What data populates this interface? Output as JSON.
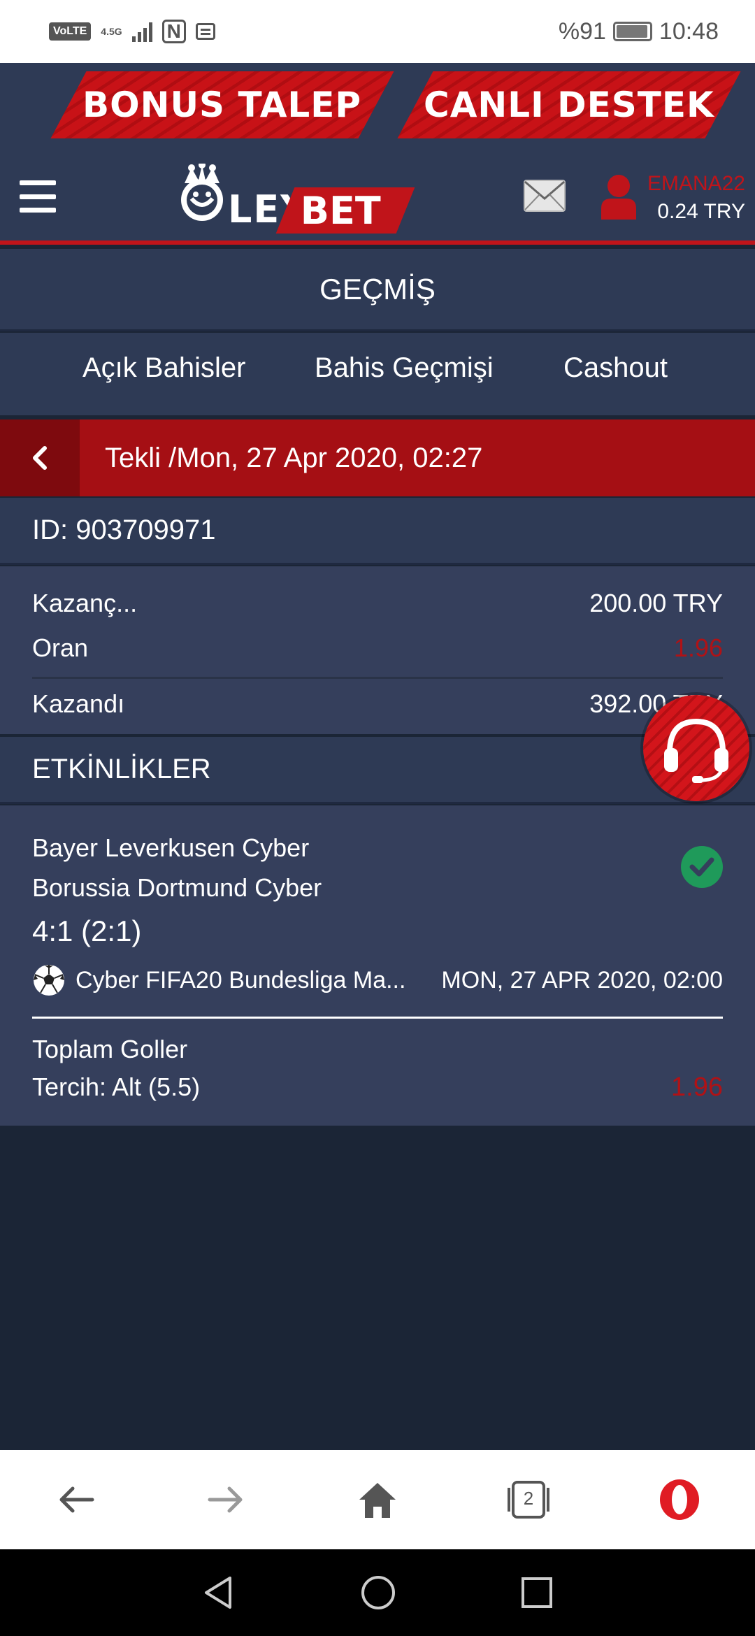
{
  "status_bar": {
    "volte": "VoLTE",
    "network": "4.5G",
    "nfc": "N",
    "battery": "%91",
    "time": "10:48"
  },
  "promo": {
    "bonus_label": "BONUS TALEP",
    "support_label": "CANLI DESTEK"
  },
  "header": {
    "logo_text": "LEY",
    "logo_bet": "BET",
    "username": "EMANA22",
    "balance": "0.24 TRY"
  },
  "page_title": "GEÇMİŞ",
  "tabs": [
    {
      "label": "Açık Bahisler"
    },
    {
      "label": "Bahis Geçmişi"
    },
    {
      "label": "Cashout"
    }
  ],
  "bet": {
    "title": "Tekli /Mon, 27 Apr 2020, 02:27",
    "id": "ID: 903709971",
    "stake_label": "Kazanç...",
    "stake_value": "200.00 TRY",
    "odds_label": "Oran",
    "odds_value": "1.96",
    "result_label": "Kazandı",
    "result_value": "392.00 TRY"
  },
  "events_title": "ETKİNLİKLER",
  "event": {
    "team_home": "Bayer Leverkusen Cyber",
    "team_away": "Borussia Dortmund Cyber",
    "score": "4:1 (2:1)",
    "league": "Cyber FIFA20 Bundesliga Ma...",
    "datetime": "MON, 27 APR 2020, 02:00",
    "market": "Toplam Goller",
    "choice": "Tercih: Alt (5.5)",
    "choice_odds": "1.96"
  },
  "browser": {
    "tab_count": "2"
  },
  "colors": {
    "brand_red": "#c0141a",
    "header_bg": "#2e3a55",
    "panel_bg": "#353f5c",
    "page_bg": "#1b2536",
    "success": "#1f9a5a"
  }
}
